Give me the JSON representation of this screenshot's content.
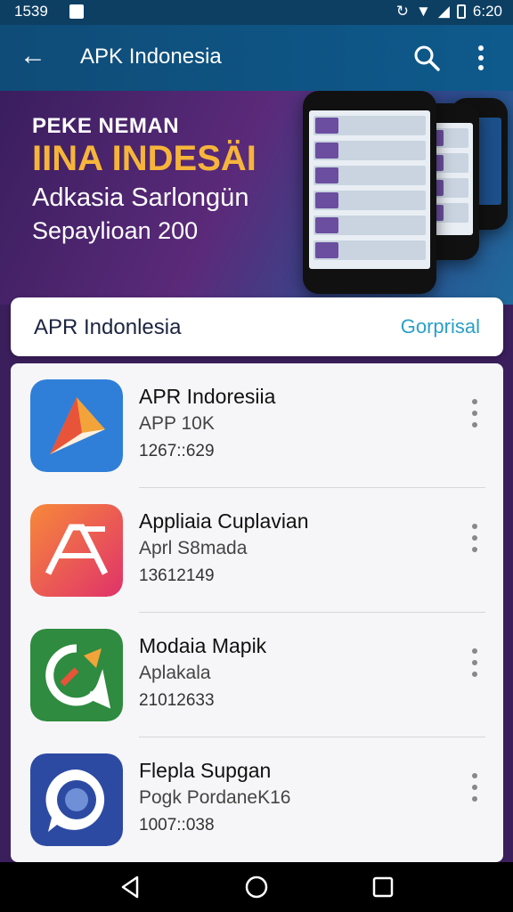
{
  "status_bar": {
    "time": "1539",
    "clock": "6:20"
  },
  "app_bar": {
    "title": "APK Indonesia"
  },
  "banner": {
    "line1": "PEKE NEMAN",
    "line2": "IINA INDESÄI",
    "line3": "Adkasia Sarlongün",
    "line4": "Sepaylioan 200"
  },
  "section": {
    "title": "APR Indonlesia",
    "link": "Gorprisal"
  },
  "apps": [
    {
      "name": "APR Indoresiia",
      "sub": "APP 10K",
      "num": "1267::629",
      "icon": "app-arrow-icon",
      "color": "#2f7fd9"
    },
    {
      "name": "Appliaia Cuplavian",
      "sub": "Aprl  S8mada",
      "num": "13612149",
      "icon": "app-a-logo-icon",
      "color": "#f0533a"
    },
    {
      "name": "Modaia Mapik",
      "sub": "Aplakala",
      "num": "21012633",
      "icon": "app-chat-icon",
      "color": "#2e8b3f"
    },
    {
      "name": "Flepla Supgan",
      "sub": "Pogk PordaneK16",
      "num": "1007::038",
      "icon": "app-lens-icon",
      "color": "#2d4aa3"
    }
  ]
}
